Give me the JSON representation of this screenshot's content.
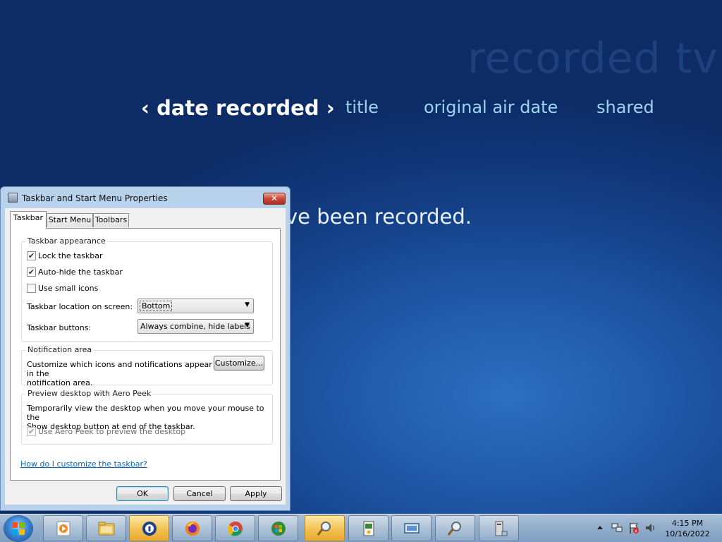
{
  "media_center": {
    "watermark": "recorded tv",
    "nav": {
      "prev_arrow": "‹",
      "active": "date recorded",
      "next_arrow": "›",
      "items": [
        "title",
        "original air date",
        "shared"
      ]
    },
    "message": "ve been recorded."
  },
  "dialog": {
    "title": "Taskbar and Start Menu Properties",
    "close_label": "✕",
    "tabs": [
      "Taskbar",
      "Start Menu",
      "Toolbars"
    ],
    "active_tab": "Taskbar",
    "appearance": {
      "group_title": "Taskbar appearance",
      "lock_label": "Lock the taskbar",
      "lock_checked": true,
      "autohide_label": "Auto-hide the taskbar",
      "autohide_checked": true,
      "small_icons_label": "Use small icons",
      "small_icons_checked": false,
      "location_label": "Taskbar location on screen:",
      "location_value": "Bottom",
      "buttons_label": "Taskbar buttons:",
      "buttons_value": "Always combine, hide labels"
    },
    "notification": {
      "group_title": "Notification area",
      "text_line1": "Customize which icons and notifications appear in the",
      "text_line2": "notification area.",
      "customize_button": "Customize..."
    },
    "aero_peek": {
      "group_title": "Preview desktop with Aero Peek",
      "text_line1": "Temporarily view the desktop when you move your mouse to the",
      "text_line2": "Show desktop button at end of the taskbar.",
      "checkbox_label": "Use Aero Peek to preview the desktop",
      "checkbox_checked": true,
      "checkbox_disabled": true
    },
    "help_link": "How do I customize the taskbar?",
    "buttons": {
      "ok": "OK",
      "cancel": "Cancel",
      "apply": "Apply"
    }
  },
  "taskbar": {
    "pinned": [
      {
        "name": "media-center-icon"
      },
      {
        "name": "explorer-folder-icon"
      },
      {
        "name": "avast-shield-icon"
      },
      {
        "name": "firefox-icon"
      },
      {
        "name": "chrome-icon"
      },
      {
        "name": "windows-media-center-icon"
      },
      {
        "name": "magnifier-icon"
      },
      {
        "name": "control-panel-icon"
      },
      {
        "name": "display-icon"
      },
      {
        "name": "magnifier-tool-icon"
      },
      {
        "name": "computer-tower-icon"
      }
    ],
    "clock": {
      "time": "4:15 PM",
      "date": "10/16/2022"
    }
  }
}
